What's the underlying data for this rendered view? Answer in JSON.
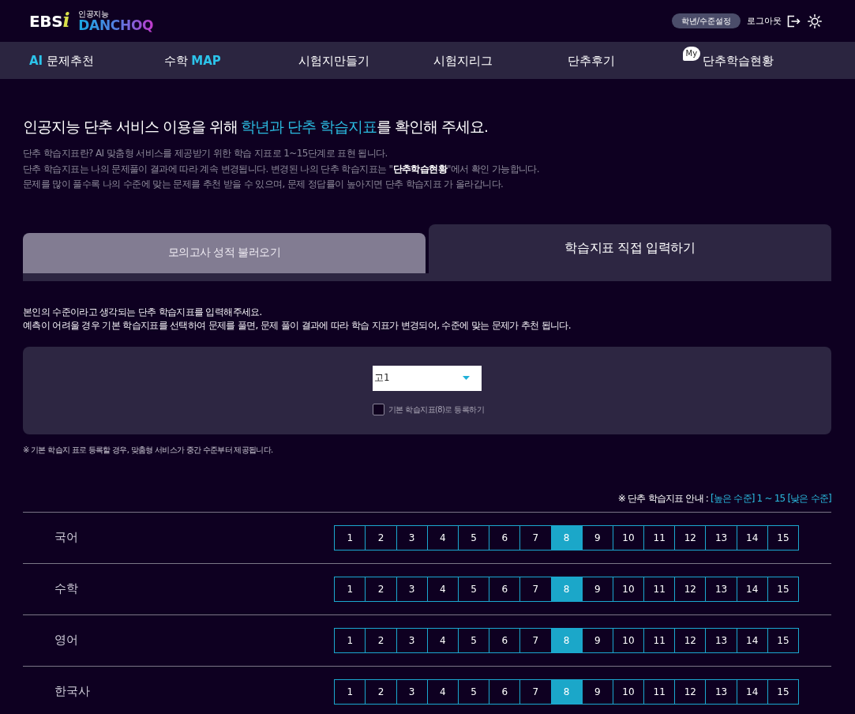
{
  "header": {
    "logo": {
      "brand": "EBS",
      "brand_mark": "i",
      "tagline": "인공지능",
      "wordmark": "DANCHOQ"
    },
    "grade_button": "학년/수준설정",
    "logout_link": "로그아웃"
  },
  "nav": [
    {
      "label": "**AI** 문제추천"
    },
    {
      "label": "수학 **MAP**"
    },
    {
      "label": "시험지만들기"
    },
    {
      "label": "시험지리그"
    },
    {
      "label": "단추후기"
    },
    {
      "label": "단추학습현황",
      "badge": "My"
    }
  ],
  "intro": {
    "title": {
      "lead": "인공지능 단추 서비스 이용을 위해",
      "highlight": "학년과 단추 학습지표",
      "tail": "를 확인해 주세요."
    },
    "lines": [
      "단추 학습지표란? AI 맞춤형 서비스를 제공받기 위한 학습 지표로 1~15단계로 표현 됩니다.",
      "단추 학습지표는 나의 문제풀이 결과에 따라 계속 변경됩니다. 변경된 나의 단추 학습지표는 \"**단추학습현황**\"에서 확인 가능합니다.",
      "문제를 많이 풀수록 나의 수준에 맞는 문제를 추천 받을 수 있으며, 문제 정답률이 높아지면 단추 학습지표 가 올라갑니다."
    ]
  },
  "tabs": [
    {
      "label": "모의고사 성적 불러오기",
      "selected": false
    },
    {
      "label": "학습지표 직접 입력하기",
      "selected": true
    }
  ],
  "instructions": [
    "본인의 수준이라고 생각되는 단추 학습지표를 입력해주세요.",
    "예측이 어려울 경우 기본 학습지표를 선택하여 문제를 풀면, 문제 풀이 결과에 따라 학습 지표가 변경되어, 수준에 맞는 문제가 추천 됩니다."
  ],
  "form": {
    "grade_select": {
      "value": "고1"
    },
    "default_checkbox": {
      "label": "기본 학습지표(8)로 등록하기",
      "checked": false
    }
  },
  "note": "※ 기본 학습지 표로 등록할 경우, 맞춤형 서비스가 중간 수준부터 제공됩니다.",
  "legend": {
    "label": "※ 단추 학습지표 안내 :",
    "scale": "[높은 수준] 1 ~ 15 [낮은 수준]"
  },
  "subjects": [
    {
      "name": "국어",
      "levels": [
        {
          "label": "1",
          "selected": false
        },
        {
          "label": "2",
          "selected": false
        },
        {
          "label": "3",
          "selected": false
        },
        {
          "label": "4",
          "selected": false
        },
        {
          "label": "5",
          "selected": false
        },
        {
          "label": "6",
          "selected": false
        },
        {
          "label": "7",
          "selected": false
        },
        {
          "label": "8",
          "selected": true
        },
        {
          "label": "9",
          "selected": false
        },
        {
          "label": "10",
          "selected": false
        },
        {
          "label": "11",
          "selected": false
        },
        {
          "label": "12",
          "selected": false
        },
        {
          "label": "13",
          "selected": false
        },
        {
          "label": "14",
          "selected": false
        },
        {
          "label": "15",
          "selected": false
        }
      ]
    },
    {
      "name": "수학",
      "levels": [
        {
          "label": "1",
          "selected": false
        },
        {
          "label": "2",
          "selected": false
        },
        {
          "label": "3",
          "selected": false
        },
        {
          "label": "4",
          "selected": false
        },
        {
          "label": "5",
          "selected": false
        },
        {
          "label": "6",
          "selected": false
        },
        {
          "label": "7",
          "selected": false
        },
        {
          "label": "8",
          "selected": true
        },
        {
          "label": "9",
          "selected": false
        },
        {
          "label": "10",
          "selected": false
        },
        {
          "label": "11",
          "selected": false
        },
        {
          "label": "12",
          "selected": false
        },
        {
          "label": "13",
          "selected": false
        },
        {
          "label": "14",
          "selected": false
        },
        {
          "label": "15",
          "selected": false
        }
      ]
    },
    {
      "name": "영어",
      "levels": [
        {
          "label": "1",
          "selected": false
        },
        {
          "label": "2",
          "selected": false
        },
        {
          "label": "3",
          "selected": false
        },
        {
          "label": "4",
          "selected": false
        },
        {
          "label": "5",
          "selected": false
        },
        {
          "label": "6",
          "selected": false
        },
        {
          "label": "7",
          "selected": false
        },
        {
          "label": "8",
          "selected": true
        },
        {
          "label": "9",
          "selected": false
        },
        {
          "label": "10",
          "selected": false
        },
        {
          "label": "11",
          "selected": false
        },
        {
          "label": "12",
          "selected": false
        },
        {
          "label": "13",
          "selected": false
        },
        {
          "label": "14",
          "selected": false
        },
        {
          "label": "15",
          "selected": false
        }
      ]
    },
    {
      "name": "한국사",
      "levels": [
        {
          "label": "1",
          "selected": false
        },
        {
          "label": "2",
          "selected": false
        },
        {
          "label": "3",
          "selected": false
        },
        {
          "label": "4",
          "selected": false
        },
        {
          "label": "5",
          "selected": false
        },
        {
          "label": "6",
          "selected": false
        },
        {
          "label": "7",
          "selected": false
        },
        {
          "label": "8",
          "selected": true
        },
        {
          "label": "9",
          "selected": false
        },
        {
          "label": "10",
          "selected": false
        },
        {
          "label": "11",
          "selected": false
        },
        {
          "label": "12",
          "selected": false
        },
        {
          "label": "13",
          "selected": false
        },
        {
          "label": "14",
          "selected": false
        },
        {
          "label": "15",
          "selected": false
        }
      ]
    }
  ]
}
